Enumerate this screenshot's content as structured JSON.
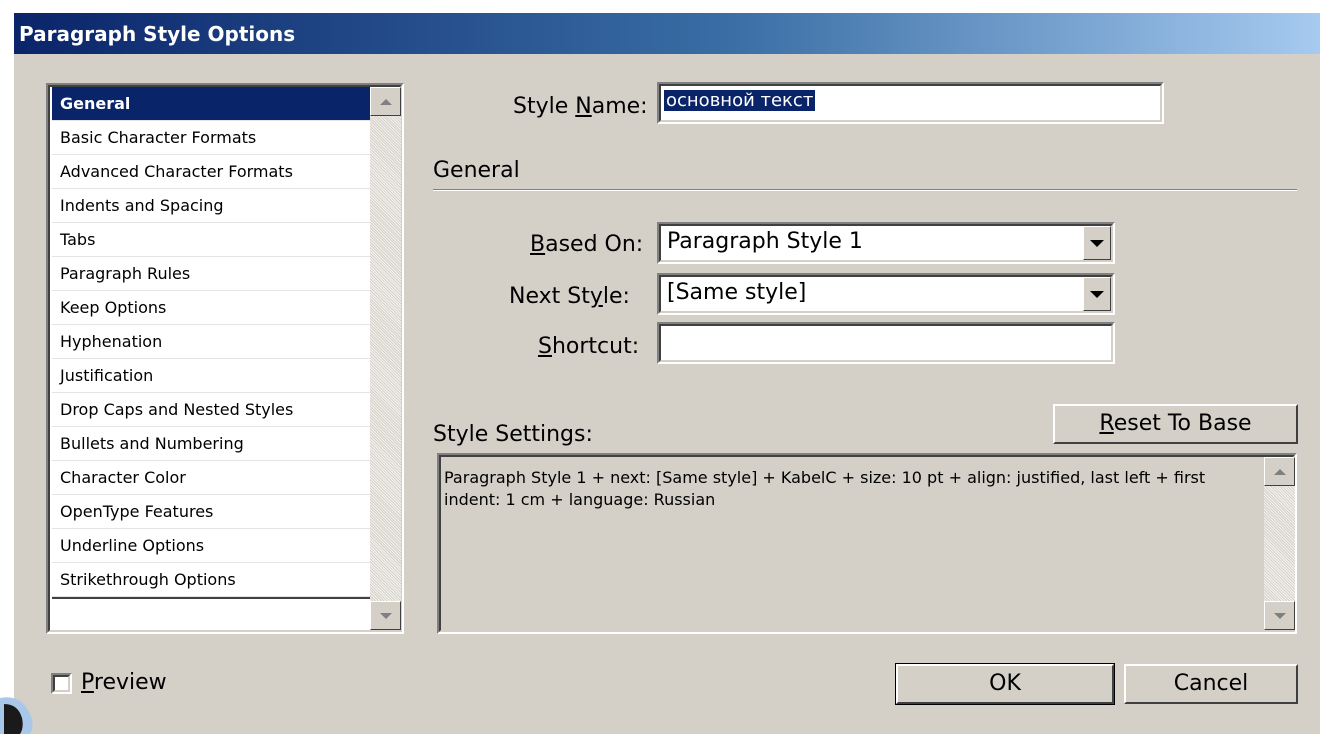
{
  "window": {
    "title": "Paragraph Style Options"
  },
  "categories": {
    "items": [
      "General",
      "Basic Character Formats",
      "Advanced Character Formats",
      "Indents and Spacing",
      "Tabs",
      "Paragraph Rules",
      "Keep Options",
      "Hyphenation",
      "Justification",
      "Drop Caps and Nested Styles",
      "Bullets and Numbering",
      "Character Color",
      "OpenType Features",
      "Underline Options",
      "Strikethrough Options"
    ],
    "selected": "General"
  },
  "style_name": {
    "label_pre": "Style ",
    "label_key": "N",
    "label_post": "ame:",
    "value": "основной текст"
  },
  "section": {
    "heading": "General"
  },
  "based_on": {
    "label_key": "B",
    "label_post": "ased On:",
    "value": "Paragraph Style 1"
  },
  "next_style": {
    "label_pre": "Next St",
    "label_key": "y",
    "label_post": "le:",
    "value": "[Same style]"
  },
  "shortcut": {
    "label_key": "S",
    "label_post": "hortcut:",
    "value": ""
  },
  "style_settings": {
    "label": "Style Settings:",
    "text": "Paragraph Style 1 + next: [Same style] + KabelC + size: 10 pt + align: justified, last left + first indent: 1 cm + language: Russian"
  },
  "reset_button": {
    "key": "R",
    "rest": "eset To Base"
  },
  "preview": {
    "key": "P",
    "rest": "review",
    "checked": false
  },
  "buttons": {
    "ok": "OK",
    "cancel": "Cancel"
  },
  "colors": {
    "selection": "#0a246a",
    "dialog_face": "#d4d0c8",
    "title_gradient_start": "#0a246a",
    "title_gradient_end": "#a6caf0"
  }
}
